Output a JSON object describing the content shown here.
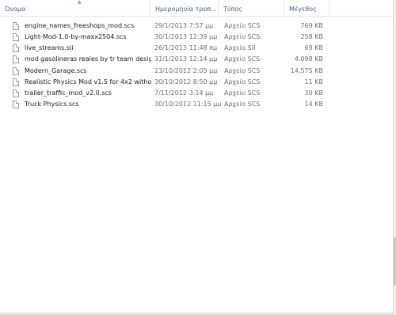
{
  "columns": {
    "name": "Όνομα",
    "date": "Ημερομηνία τροπ...",
    "type": "Τύπος",
    "size": "Μέγεθος"
  },
  "sort": {
    "column": "name",
    "direction": "ascending",
    "icon": "chevron-up-icon"
  },
  "files": [
    {
      "name": "engine_names_freeshops_mod.scs",
      "date": "29/1/2013 7:57 μμ",
      "type": "Αρχείο SCS",
      "size": "769 KB"
    },
    {
      "name": "Light-Mod-1.0-by-maxx2504.scs",
      "date": "30/1/2013 12:39 μμ",
      "type": "Αρχείο SCS",
      "size": "258 KB"
    },
    {
      "name": "live_streams.sii",
      "date": "26/1/2013 11:48 πμ",
      "type": "Αρχείο SII",
      "size": "69 KB"
    },
    {
      "name": "mod gasolineras reales by tr team design...",
      "date": "31/1/2013 12:14 μμ",
      "type": "Αρχείο SCS",
      "size": "4.098 KB"
    },
    {
      "name": "Modern_Garage.scs",
      "date": "23/10/2012 2:05 μμ",
      "type": "Αρχείο SCS",
      "size": "14.575 KB"
    },
    {
      "name": "Realistic Physics Mod v1.5 for 4x2 withou...",
      "date": "30/10/2012 8:50 μμ",
      "type": "Αρχείο SCS",
      "size": "11 KB"
    },
    {
      "name": "trailer_traffic_mod_v2.0.scs",
      "date": "7/11/2012 3:14 μμ",
      "type": "Αρχείο SCS",
      "size": "30 KB"
    },
    {
      "name": "Truck Physics.scs",
      "date": "30/10/2012 11:15 μμ",
      "type": "Αρχείο SCS",
      "size": "14 KB"
    }
  ]
}
